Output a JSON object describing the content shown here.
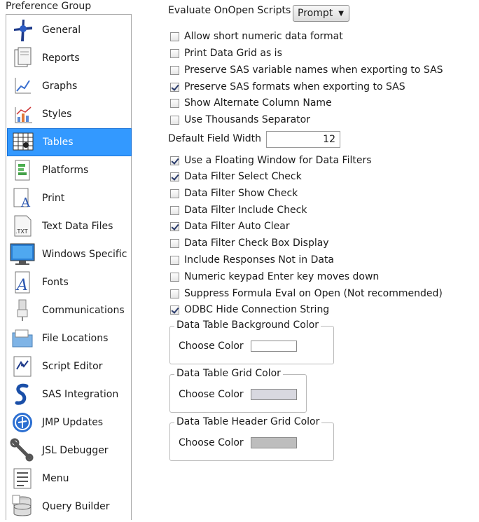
{
  "preference_group": {
    "label": "Preference Group",
    "selected": "Tables",
    "items": [
      {
        "label": "General",
        "icon": "general-icon"
      },
      {
        "label": "Reports",
        "icon": "reports-icon"
      },
      {
        "label": "Graphs",
        "icon": "graphs-icon"
      },
      {
        "label": "Styles",
        "icon": "styles-icon"
      },
      {
        "label": "Tables",
        "icon": "tables-icon"
      },
      {
        "label": "Platforms",
        "icon": "platforms-icon"
      },
      {
        "label": "Print",
        "icon": "print-icon"
      },
      {
        "label": "Text Data Files",
        "icon": "text-data-files-icon"
      },
      {
        "label": "Windows Specific",
        "icon": "windows-specific-icon"
      },
      {
        "label": "Fonts",
        "icon": "fonts-icon"
      },
      {
        "label": "Communications",
        "icon": "communications-icon"
      },
      {
        "label": "File Locations",
        "icon": "file-locations-icon"
      },
      {
        "label": "Script Editor",
        "icon": "script-editor-icon"
      },
      {
        "label": "SAS Integration",
        "icon": "sas-integration-icon"
      },
      {
        "label": "JMP Updates",
        "icon": "jmp-updates-icon"
      },
      {
        "label": "JSL Debugger",
        "icon": "jsl-debugger-icon"
      },
      {
        "label": "Menu",
        "icon": "menu-icon"
      },
      {
        "label": "Query Builder",
        "icon": "query-builder-icon"
      }
    ]
  },
  "evaluate_onopen": {
    "label": "Evaluate OnOpen Scripts",
    "value": "Prompt"
  },
  "options_top": [
    {
      "label": "Allow short numeric data format",
      "checked": false
    },
    {
      "label": "Print Data Grid as is",
      "checked": false
    },
    {
      "label": "Preserve SAS variable names when exporting to SAS",
      "checked": false
    },
    {
      "label": "Preserve SAS formats when exporting to SAS",
      "checked": true
    },
    {
      "label": "Show Alternate Column Name",
      "checked": false
    },
    {
      "label": "Use Thousands Separator",
      "checked": false
    }
  ],
  "default_field_width": {
    "label": "Default Field Width",
    "value": "12"
  },
  "options_bottom": [
    {
      "label": "Use a Floating Window for Data Filters",
      "checked": true
    },
    {
      "label": "Data Filter Select Check",
      "checked": true
    },
    {
      "label": "Data Filter Show Check",
      "checked": false
    },
    {
      "label": "Data Filter Include Check",
      "checked": false
    },
    {
      "label": "Data Filter Auto Clear",
      "checked": true
    },
    {
      "label": "Data Filter Check Box Display",
      "checked": false
    },
    {
      "label": "Include Responses Not in Data",
      "checked": false
    },
    {
      "label": "Numeric keypad Enter key moves down",
      "checked": false
    },
    {
      "label": "Suppress Formula Eval on Open (Not recommended)",
      "checked": false
    },
    {
      "label": "ODBC Hide Connection String",
      "checked": true
    }
  ],
  "color_groups": [
    {
      "legend": "Data Table Background Color",
      "button": "Choose Color",
      "color": "#ffffff"
    },
    {
      "legend": "Data Table Grid Color",
      "button": "Choose Color",
      "color": "#d8d8e0"
    },
    {
      "legend": "Data Table Header Grid Color",
      "button": "Choose Color",
      "color": "#bdbdbd"
    }
  ],
  "colors": {
    "selection": "#3399ff",
    "border": "#a9a9a9",
    "check": "#2a3b6b"
  }
}
